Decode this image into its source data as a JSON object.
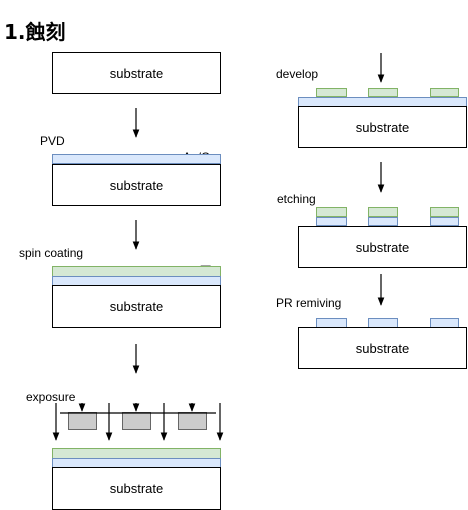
{
  "title": "1.蝕刻",
  "substrate_label": "substrate",
  "steps": {
    "pvd": {
      "label": "PVD",
      "layer": "Au/Cr"
    },
    "spin": {
      "label": "spin coating",
      "layer": "PR正"
    },
    "exposure": {
      "label": "exposure"
    },
    "develop": {
      "label": "develop"
    },
    "etching": {
      "label": "etching"
    },
    "removing": {
      "label": "PR remiving"
    }
  },
  "colors": {
    "metal_fill": "#dae8fc",
    "metal_stroke": "#6c8ebf",
    "pr_fill": "#d5e8d4",
    "pr_stroke": "#82b366",
    "mask_fill": "#cccccc",
    "mask_stroke": "#666666"
  }
}
